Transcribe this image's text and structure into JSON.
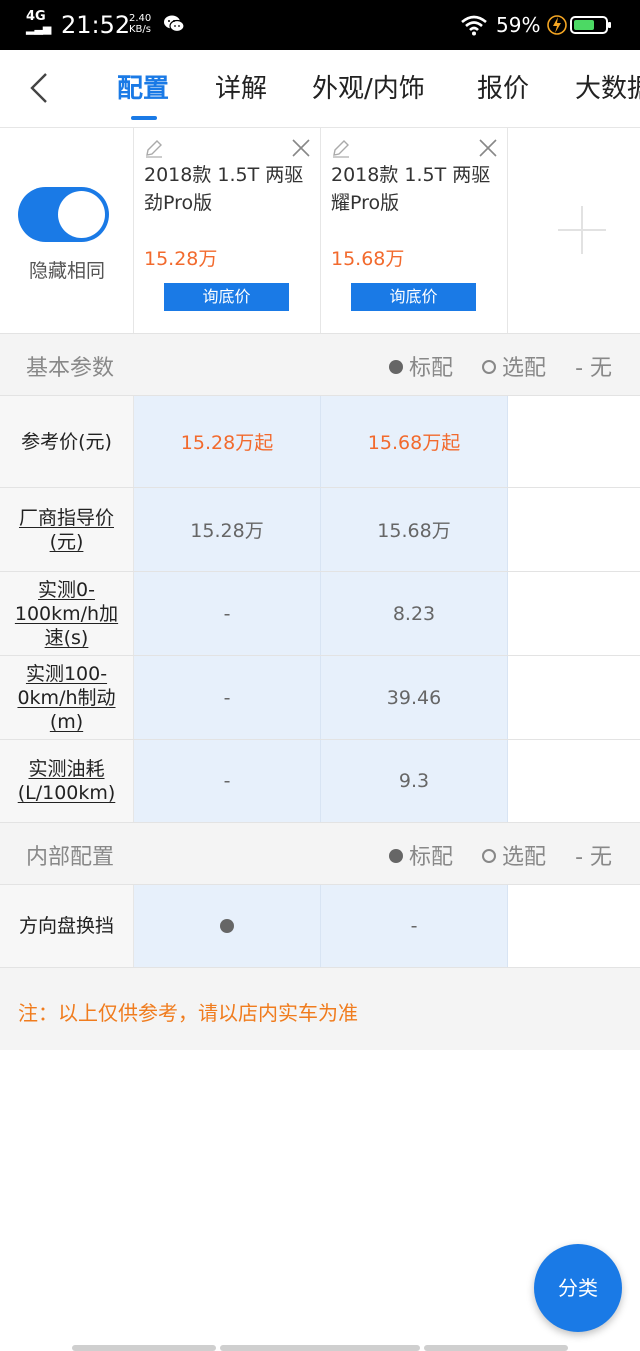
{
  "status_bar": {
    "network": "4G",
    "time": "21:52",
    "speed_value": "2.40",
    "speed_unit": "KB/s",
    "battery_percent": "59%"
  },
  "nav": {
    "tabs": [
      {
        "label": "配置",
        "active": true
      },
      {
        "label": "详解",
        "active": false
      },
      {
        "label": "外观/内饰",
        "active": false
      },
      {
        "label": "报价",
        "active": false
      },
      {
        "label": "大数据",
        "active": false
      }
    ]
  },
  "header": {
    "toggle_label": "隐藏相同",
    "toggle_on": true,
    "cars": [
      {
        "name": "2018款 1.5T 两驱劲Pro版",
        "price": "15.28万",
        "quote_label": "询底价"
      },
      {
        "name": "2018款 1.5T 两驱耀Pro版",
        "price": "15.68万",
        "quote_label": "询底价"
      }
    ]
  },
  "legend": {
    "standard": "标配",
    "optional": "选配",
    "none": "- 无"
  },
  "sections": [
    {
      "title": "基本参数",
      "rows": [
        {
          "label": "参考价(元)",
          "values": [
            "15.28万起",
            "15.68万起"
          ]
        },
        {
          "label": "厂商指导价(元)",
          "values": [
            "15.28万",
            "15.68万"
          ]
        },
        {
          "label": "实测0-100km/h加速(s)",
          "values": [
            "-",
            "8.23"
          ]
        },
        {
          "label": "实测100-0km/h制动(m)",
          "values": [
            "-",
            "39.46"
          ]
        },
        {
          "label": "实测油耗(L/100km)",
          "values": [
            "-",
            "9.3"
          ]
        }
      ]
    },
    {
      "title": "内部配置",
      "rows": [
        {
          "label": "方向盘换挡",
          "values": [
            "●",
            "-"
          ]
        }
      ]
    }
  ],
  "note": "注：以上仅供参考，请以店内实车为准",
  "fab_label": "分类",
  "colors": {
    "accent": "#1a7ae6",
    "price": "#f26a2d",
    "note": "#f07c1e",
    "cell_bg": "#e7f0fb"
  }
}
